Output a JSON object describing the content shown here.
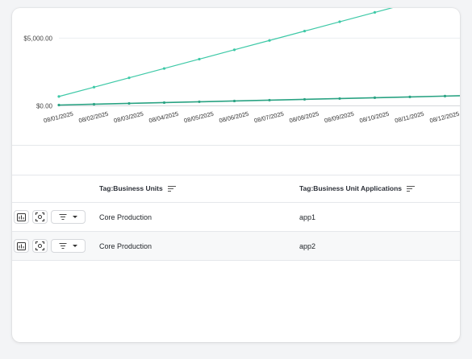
{
  "chart_data": {
    "type": "line",
    "x": [
      "08/01/2025",
      "08/02/2025",
      "08/03/2025",
      "08/04/2025",
      "08/05/2025",
      "08/06/2025",
      "08/07/2025",
      "08/08/2025",
      "08/09/2025",
      "08/10/2025",
      "08/11/2025",
      "08/12/2025",
      "08/13/2025"
    ],
    "series": [
      {
        "name": "",
        "color": "#3ec9a7",
        "values": [
          690,
          1380,
          2070,
          2760,
          3450,
          4140,
          4830,
          5520,
          6210,
          6900,
          7590,
          8280,
          8970
        ]
      },
      {
        "name": "",
        "color": "#2aa383",
        "values": [
          60,
          120,
          180,
          240,
          300,
          360,
          420,
          480,
          540,
          600,
          660,
          720,
          780
        ]
      }
    ],
    "yticks": [
      {
        "value": 0,
        "label": "$0.00"
      },
      {
        "value": 5000,
        "label": "$5,000.00"
      }
    ],
    "ylim": [
      0,
      7400
    ],
    "grid": true
  },
  "table": {
    "columns": [
      {
        "label": "Tag:Business Units"
      },
      {
        "label": "Tag:Business Unit Applications"
      }
    ],
    "rows": [
      {
        "business_unit": "Core Production",
        "application": "app1"
      },
      {
        "business_unit": "Core Production",
        "application": "app2"
      }
    ]
  },
  "icons": {
    "row_action_1": "chart-icon",
    "row_action_2": "focus-icon",
    "row_filter": "filter-icon",
    "sort": "sort-icon"
  }
}
